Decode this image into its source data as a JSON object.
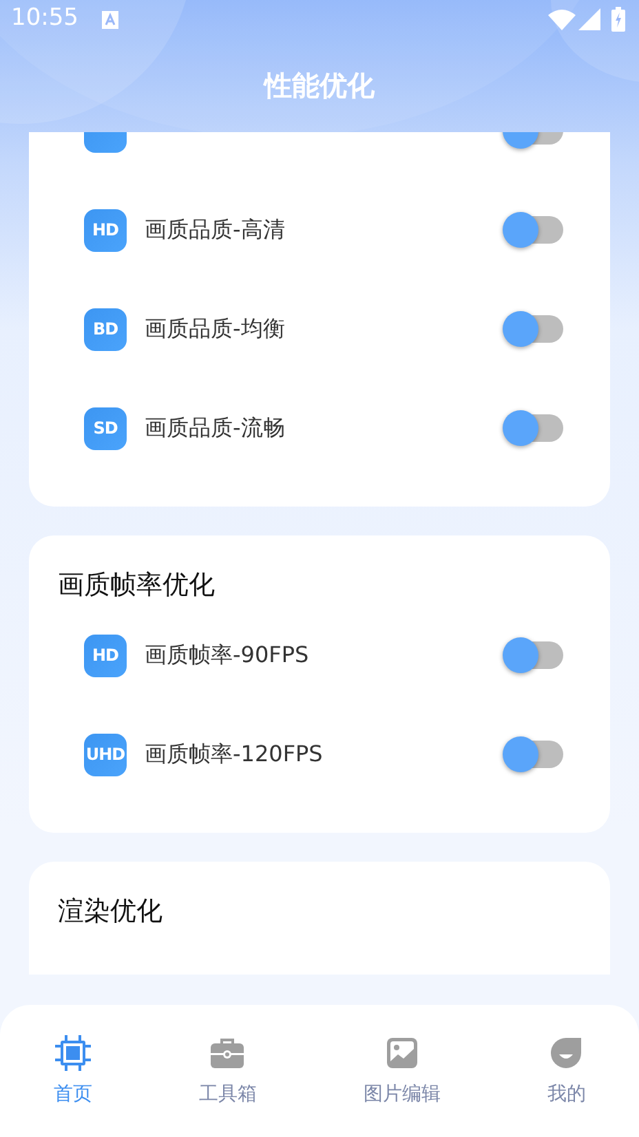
{
  "status_bar": {
    "time": "10:55"
  },
  "header": {
    "title": "性能优化"
  },
  "sections": [
    {
      "rows": [
        {
          "on": false
        },
        {
          "badge": "HD",
          "label": "画质品质-高清",
          "on": false
        },
        {
          "badge": "BD",
          "label": "画质品质-均衡",
          "on": false
        },
        {
          "badge": "SD",
          "label": "画质品质-流畅",
          "on": false
        }
      ]
    },
    {
      "title": "画质帧率优化",
      "rows": [
        {
          "badge": "HD",
          "label": "画质帧率-90FPS",
          "on": false
        },
        {
          "badge": "UHD",
          "label": "画质帧率-120FPS",
          "on": false
        }
      ]
    },
    {
      "title": "渲染优化"
    }
  ],
  "bottom_nav": [
    {
      "kind": "chip",
      "label": "首页",
      "selected": true
    },
    {
      "kind": "toolbox",
      "label": "工具箱",
      "selected": false
    },
    {
      "kind": "image",
      "label": "图片编辑",
      "selected": false
    },
    {
      "kind": "face",
      "label": "我的",
      "selected": false
    }
  ]
}
